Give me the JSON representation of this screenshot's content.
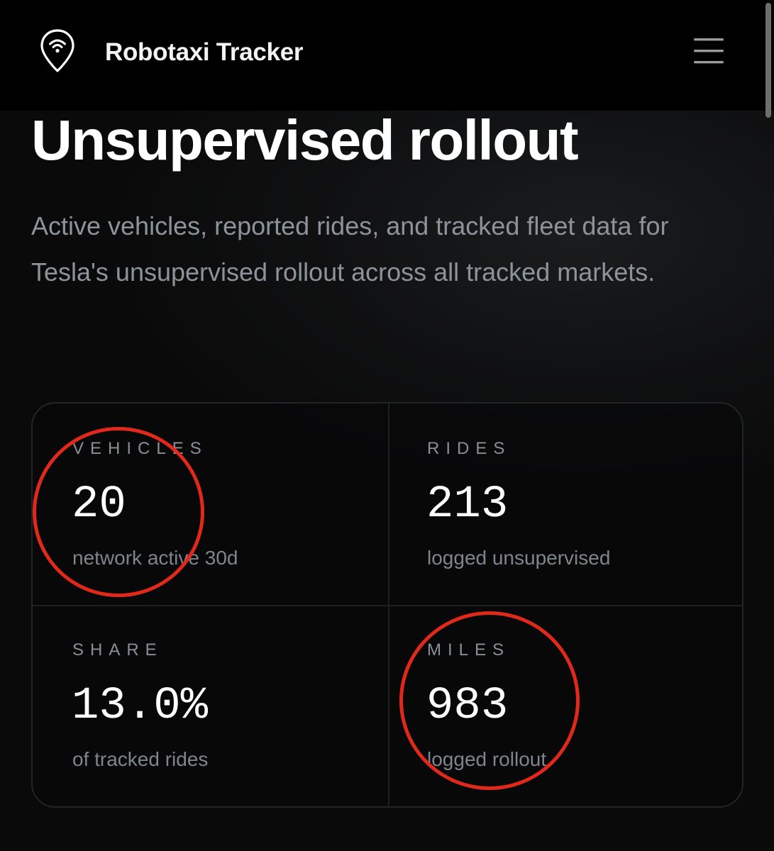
{
  "header": {
    "brand": "Robotaxi Tracker",
    "logo_icon": "map-pin-signal-icon",
    "menu_icon": "hamburger-menu-icon"
  },
  "page": {
    "title": "Unsupervised rollout",
    "description": "Active vehicles, reported rides, and tracked fleet data for Tesla's unsupervised rollout across all tracked markets."
  },
  "stats": [
    {
      "label": "VEHICLES",
      "value": "20",
      "note": "network active 30d"
    },
    {
      "label": "RIDES",
      "value": "213",
      "note": "logged unsupervised"
    },
    {
      "label": "SHARE",
      "value": "13.0%",
      "note": "of tracked rides"
    },
    {
      "label": "MILES",
      "value": "983",
      "note": "logged rollout"
    }
  ],
  "annotations": {
    "highlight_color": "#e0281b",
    "circled_stats": [
      "VEHICLES",
      "MILES"
    ]
  },
  "colors": {
    "background": "#0a0a0a",
    "topbar": "#000000",
    "muted_text": "#8d939b"
  }
}
